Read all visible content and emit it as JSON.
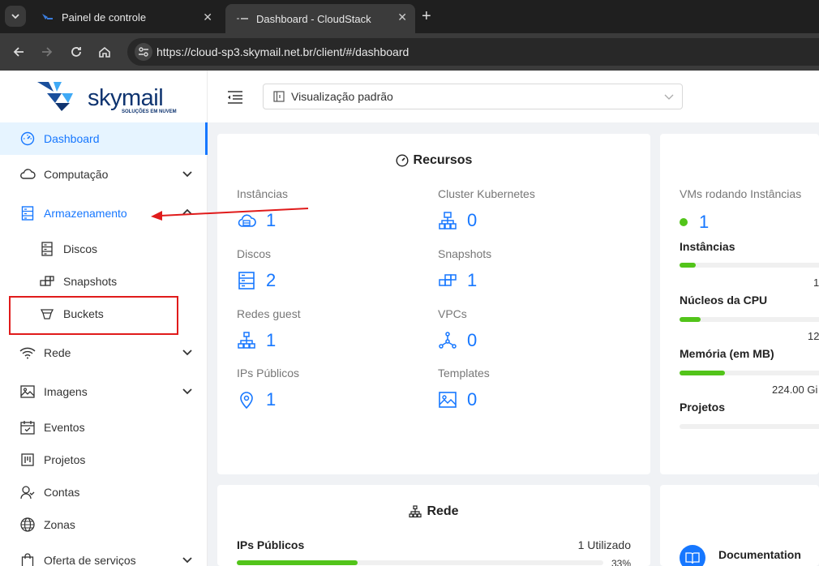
{
  "browser": {
    "tabs": [
      {
        "title": "Painel de controle",
        "active": false
      },
      {
        "title": "Dashboard - CloudStack",
        "active": true
      }
    ],
    "url": "https://cloud-sp3.skymail.net.br/client/#/dashboard"
  },
  "logo": {
    "name": "skymail",
    "tagline": "SOLUÇÕES EM NUVEM"
  },
  "sidebar": {
    "items": [
      {
        "label": "Dashboard",
        "icon": "dashboard-icon"
      },
      {
        "label": "Computação",
        "icon": "cloud-icon"
      },
      {
        "label": "Armazenamento",
        "icon": "database-icon"
      },
      {
        "label": "Discos",
        "icon": "disk-icon"
      },
      {
        "label": "Snapshots",
        "icon": "snapshot-icon"
      },
      {
        "label": "Buckets",
        "icon": "bucket-icon"
      },
      {
        "label": "Rede",
        "icon": "wifi-icon"
      },
      {
        "label": "Imagens",
        "icon": "image-icon"
      },
      {
        "label": "Eventos",
        "icon": "calendar-icon"
      },
      {
        "label": "Projetos",
        "icon": "project-icon"
      },
      {
        "label": "Contas",
        "icon": "users-icon"
      },
      {
        "label": "Zonas",
        "icon": "globe-icon"
      },
      {
        "label": "Oferta de serviços",
        "icon": "shopping-icon"
      }
    ]
  },
  "header": {
    "view_select": "Visualização padrão"
  },
  "resources": {
    "title": "Recursos",
    "left": [
      {
        "label": "Instâncias",
        "value": "1"
      },
      {
        "label": "Discos",
        "value": "2"
      },
      {
        "label": "Redes guest",
        "value": "1"
      },
      {
        "label": "IPs Públicos",
        "value": "1"
      }
    ],
    "right": [
      {
        "label": "Cluster Kubernetes",
        "value": "0"
      },
      {
        "label": "Snapshots",
        "value": "1"
      },
      {
        "label": "VPCs",
        "value": "0"
      },
      {
        "label": "Templates",
        "value": "0"
      }
    ]
  },
  "stats": {
    "running_label": "VMs rodando Instâncias",
    "running_value": "1",
    "items": [
      {
        "label": "Instâncias",
        "value": "1",
        "fill": 0.1
      },
      {
        "label": "Núcleos da CPU",
        "value": "12",
        "fill": 0.13
      },
      {
        "label": "Memória (em MB)",
        "value": "224.00 Gi",
        "fill": 0.28
      },
      {
        "label": "Projetos",
        "value": "",
        "fill": 0
      }
    ]
  },
  "network": {
    "title": "Rede",
    "label": "IPs Públicos",
    "used": "1 Utilizado",
    "percent": "33%",
    "fill": 0.33
  },
  "docs": {
    "label": "Documentation"
  },
  "colors": {
    "accent": "#1677ff",
    "success": "#52c41a",
    "annotation": "#e01b1b"
  }
}
